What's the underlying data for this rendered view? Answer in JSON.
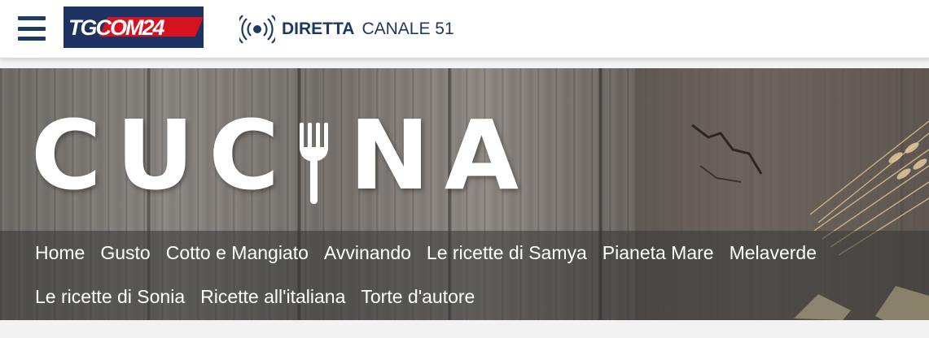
{
  "header": {
    "logo_text": "TGCOM24",
    "live_label": "DIRETTA",
    "channel_label": "CANALE 51"
  },
  "banner": {
    "title_before_fork": "CUC",
    "title_after_fork": "NA"
  },
  "nav": {
    "row1": [
      "Home",
      "Gusto",
      "Cotto e Mangiato",
      "Avvinando",
      "Le ricette di Samya",
      "Pianeta Mare",
      "Melaverde"
    ],
    "row2": [
      "Le ricette di Sonia",
      "Ricette all'italiana",
      "Torte d'autore"
    ]
  },
  "colors": {
    "brand_blue": "#1c3364",
    "brand_red": "#d6121f",
    "header_text": "#1d3a63"
  }
}
